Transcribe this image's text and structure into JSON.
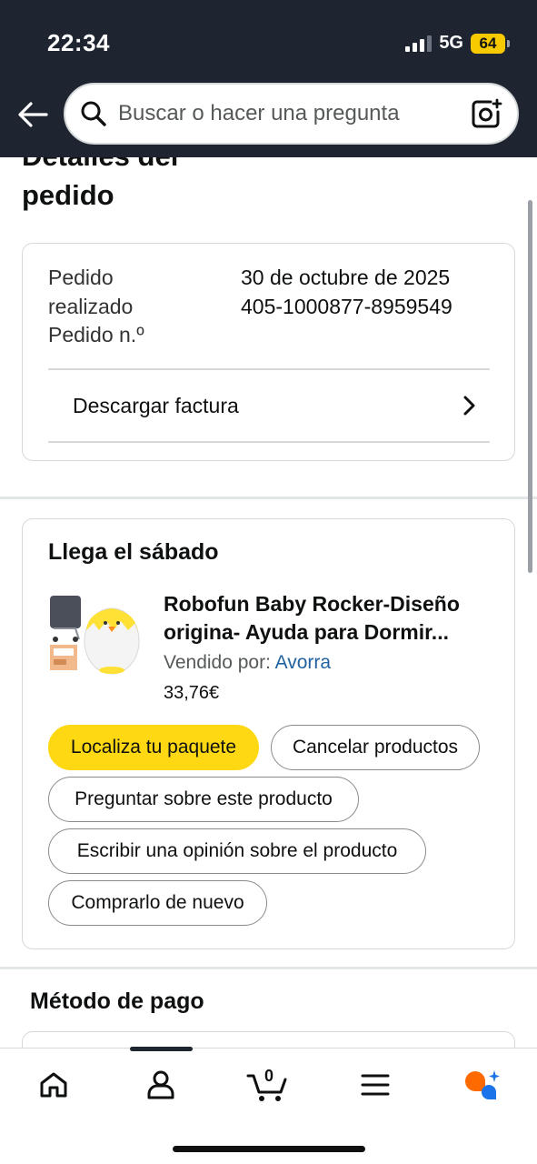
{
  "status_bar": {
    "time": "22:34",
    "network": "5G",
    "battery": "64"
  },
  "search": {
    "placeholder": "Buscar o hacer una pregunta"
  },
  "page": {
    "title_line1": "Detalles del",
    "title_line2": "pedido"
  },
  "order_info": {
    "placed_label_1": "Pedido",
    "placed_label_2": "realizado",
    "number_label": "Pedido n.º",
    "placed_date": "30 de octubre de 2025",
    "order_number": "405-1000877-8959549",
    "download_invoice": "Descargar factura"
  },
  "delivery": {
    "title": "Llega el sábado",
    "product_name_line1": "Robofun Baby Rocker-Diseño",
    "product_name_line2": "origina- Ayuda para Dormir...",
    "sold_by_label": "Vendido por: ",
    "seller": "Avorra",
    "price": "33,76€",
    "buttons": {
      "track": "Localiza tu paquete",
      "cancel": "Cancelar productos",
      "ask": "Preguntar sobre este producto",
      "review": "Escribir una opinión sobre el producto",
      "buy_again": "Comprarlo de nuevo"
    }
  },
  "payment": {
    "title": "Método de pago"
  },
  "bottom_nav": {
    "cart_count": "0"
  },
  "colors": {
    "header_bg": "#1e2530",
    "primary_button": "#ffd814",
    "link": "#2162a1",
    "battery": "#f7ca00",
    "assistant_orange": "#ff6a00",
    "assistant_blue": "#1a73e8"
  },
  "icons": [
    "back-arrow-icon",
    "search-icon",
    "camera-lens-icon",
    "chevron-right-icon",
    "home-icon",
    "account-icon",
    "cart-icon",
    "menu-icon",
    "rufus-assistant-icon"
  ]
}
